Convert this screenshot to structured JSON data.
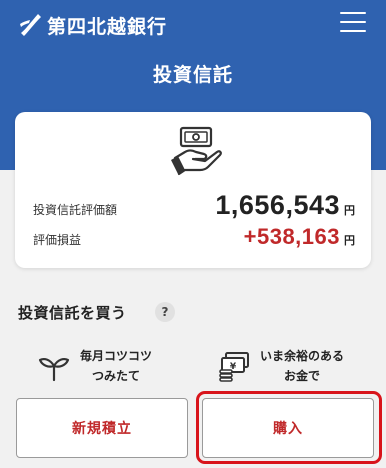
{
  "header": {
    "bank_name": "第四北越銀行",
    "menu_icon": "hamburger-menu-icon",
    "brand_color": "#2f62b0"
  },
  "page": {
    "title": "投資信託"
  },
  "summary": {
    "icon": "money-hand-icon",
    "valuation_label": "投資信託評価額",
    "valuation_value": "1,656,543",
    "valuation_unit": "円",
    "gain_label": "評価損益",
    "gain_value": "+538,163",
    "gain_unit": "円",
    "gain_color": "#c0292a"
  },
  "buy_section": {
    "title": "投資信託を買う",
    "help_label": "?",
    "options": [
      {
        "icon": "sprout-icon",
        "line1": "毎月コツコツ",
        "line2": "つみたて"
      },
      {
        "icon": "cash-stack-icon",
        "line1": "いま余裕のある",
        "line2": "お金で"
      }
    ],
    "new_plan_label": "新規積立",
    "purchase_label": "購入"
  }
}
